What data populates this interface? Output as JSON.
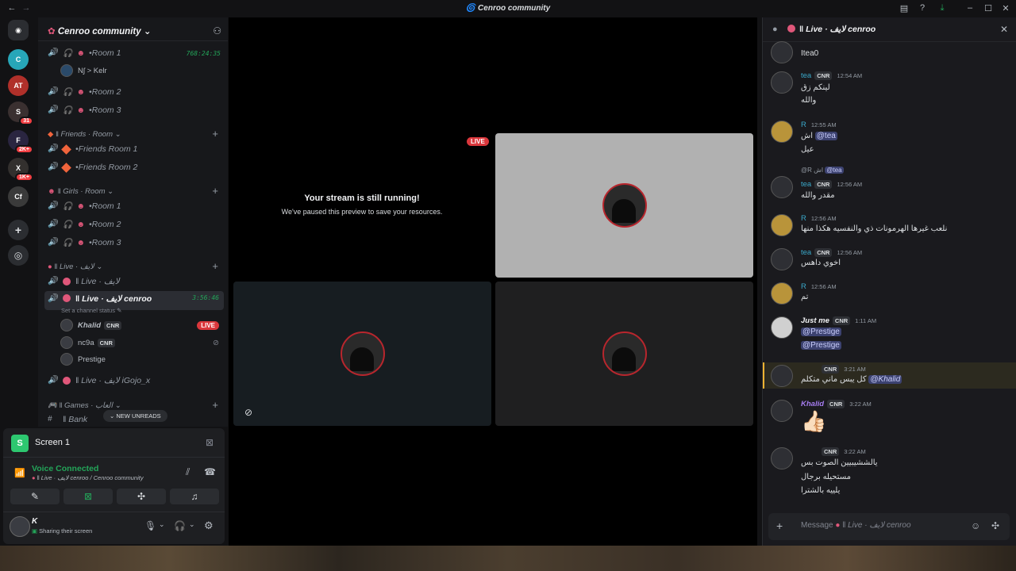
{
  "app": {
    "title": "Cenroo community"
  },
  "server": {
    "name": "Cenroo community"
  },
  "guild_badges": [
    "31",
    "2K+",
    "1K+"
  ],
  "channels": {
    "room1": "Room 1",
    "room1_timer": "768:24:35",
    "room1_user": "Nʃ > Kelr",
    "room2": "Room 2",
    "room3": "Room 3",
    "friends_cat": "‖ Friends · Room",
    "friends_room1": "Friends Room 1",
    "friends_room2": "Friends Room 2",
    "girls_cat": "‖ Girls · Room",
    "g_room1": "Room 1",
    "g_room2": "Room 2",
    "g_room3": "Room 3",
    "live_cat": "‖ Live · لايف",
    "live1": "‖ Live · لايف",
    "live_active": "‖ Live · لايف cenroo",
    "live_timer": "3:56:46",
    "status_hint": "Set a channel status",
    "users": [
      {
        "name": "Khalid",
        "tag": "CNR",
        "badge": "LIVE"
      },
      {
        "name": "nc9a",
        "tag": "CNR"
      },
      {
        "name": "Prestige"
      }
    ],
    "live_gojo": "‖ Live · لايف iGojo_x",
    "games_cat": "‖ Games · العاب",
    "bank": "‖ Bank",
    "new_unreads": "NEW UNREADS"
  },
  "panel": {
    "screen_label": "Screen 1",
    "voice_status": "Voice Connected",
    "voice_channel": "‖ Live · لايف cenroo / Cenroo community",
    "user_name": "K",
    "user_status": "Sharing their screen"
  },
  "stage": {
    "live_badge": "LIVE",
    "paused_title": "Your stream is still running!",
    "paused_sub": "We've paused this preview to save your resources."
  },
  "chat": {
    "header": "‖ Live · لايف cenroo",
    "messages": [
      {
        "text": "Itea0"
      },
      {
        "name": "tea",
        "tag": "CNR",
        "time": "12:54 AM",
        "lines": [
          "لينكم زق",
          "والله"
        ]
      },
      {
        "name": "R",
        "time": "12:55 AM",
        "pre": "اش",
        "mention": "@tea",
        "line2": "عيل"
      },
      {
        "reply": "@R اش",
        "reply_mention": "@tea",
        "name": "tea",
        "tag": "CNR",
        "time": "12:56 AM",
        "line": "مقدر والله"
      },
      {
        "name": "R",
        "time": "12:56 AM",
        "line": "نلعب غيرها الهرمونات ذي والنفسيه هكذا منها"
      },
      {
        "name": "tea",
        "tag": "CNR",
        "time": "12:56 AM",
        "line": "اخوي داهس"
      },
      {
        "name": "R",
        "time": "12:56 AM",
        "line": "تم"
      },
      {
        "name": "Just me",
        "tag": "CNR",
        "time": "1:11 AM",
        "m1": "@Prestige",
        "m2": "@Prestige"
      },
      {
        "tag": "CNR",
        "time": "3:21 AM",
        "line": "كل يبس ماني متكلم",
        "mention": "@Khalid"
      },
      {
        "name": "Khalid",
        "tag": "CNR",
        "time": "3:22 AM",
        "emoji": "👍🏻"
      },
      {
        "tag": "CNR",
        "time": "3:22 AM",
        "lines": [
          "يالششيبيين الصوت بس",
          "مستحيله برجال",
          "يلييه بالشترا"
        ]
      }
    ],
    "composer_prefix": "Message",
    "composer_channel": "‖ Live · لايف cenroo"
  },
  "colors": {
    "accent": "#23a559",
    "live": "#da373c",
    "mention": "#3c4270",
    "pink": "#e0577a"
  }
}
